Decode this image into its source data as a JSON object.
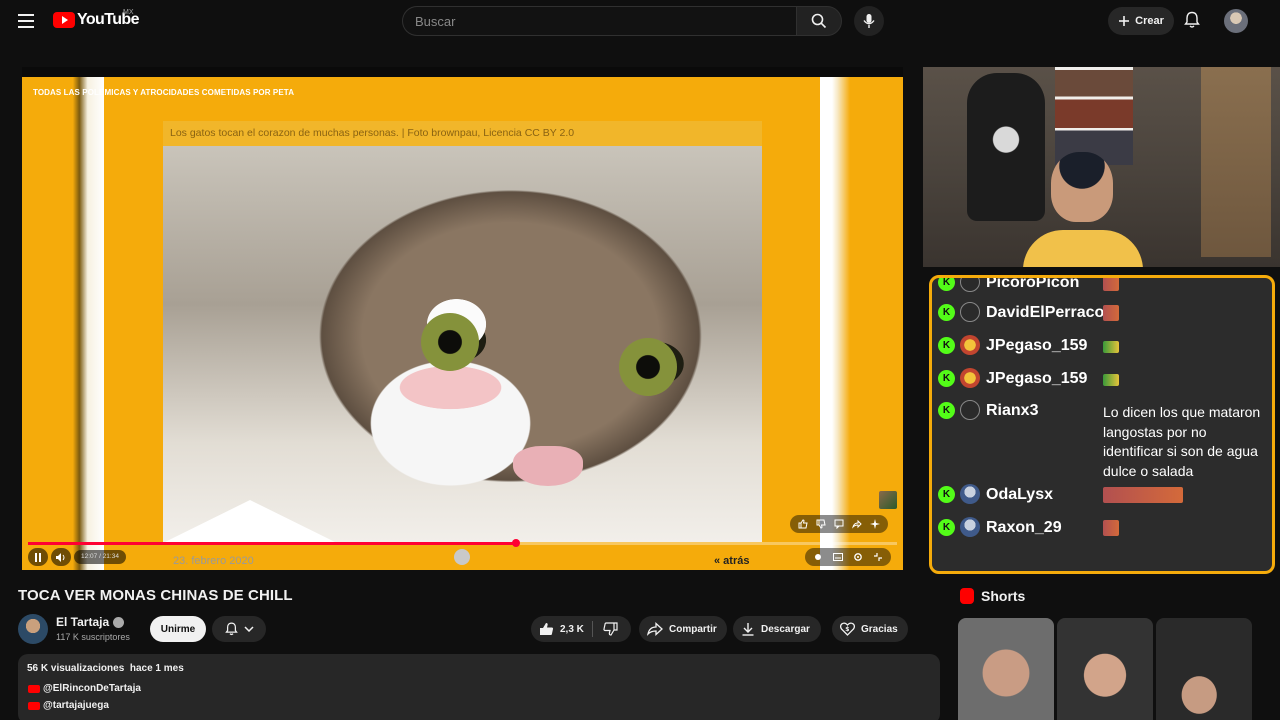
{
  "header": {
    "logo_text": "YouTube",
    "country_code": "MX",
    "search_placeholder": "Buscar",
    "create_label": "Crear"
  },
  "player": {
    "page_heading": "TODAS LAS POLEMICAS Y ATROCIDADES COMETIDAS POR PETA",
    "image_caption": "Los gatos tocan el corazon de muchas personas. | Foto  brownpau, Licencia  CC BY 2.0",
    "date_text": "23. febrero 2020",
    "back_link": "« atrás",
    "time_display": "12:07 / 21:34",
    "progress_fraction": 0.562
  },
  "chat": {
    "accent_color": "#f5ab0b",
    "messages": [
      {
        "user": "PicoroPicon",
        "avatar": "person-icon",
        "message": ""
      },
      {
        "user": "DavidElPerraco",
        "avatar": "person-icon",
        "message": ""
      },
      {
        "user": "JPegaso_159",
        "avatar": "pokemon-avatar",
        "message": ""
      },
      {
        "user": "JPegaso_159",
        "avatar": "pokemon-avatar",
        "message": ""
      },
      {
        "user": "Rianx3",
        "avatar": "person-icon",
        "message": "Lo dicen los que mataron langostas por no identificar si son de agua dulce o salada"
      },
      {
        "user": "OdaLysx",
        "avatar": "character-avatar",
        "message": ""
      },
      {
        "user": "Raxon_29",
        "avatar": "character-avatar",
        "message": ""
      }
    ]
  },
  "video": {
    "title": "TOCA VER MONAS CHINAS DE CHILL",
    "channel_name": "El Tartaja",
    "subscribers": "117 K suscriptores",
    "join_label": "Unirme",
    "likes": "2,3 K",
    "share_label": "Compartir",
    "download_label": "Descargar",
    "thanks_label": "Gracias",
    "views": "56 K visualizaciones",
    "published": "hace 1 mes",
    "links": [
      "@ElRinconDeTartaja",
      "@tartajajuega"
    ]
  },
  "shorts": {
    "title": "Shorts"
  },
  "colors": {
    "youtube_red": "#ff0000",
    "kick_green": "#53fc18",
    "background": "#0f0f0f"
  }
}
